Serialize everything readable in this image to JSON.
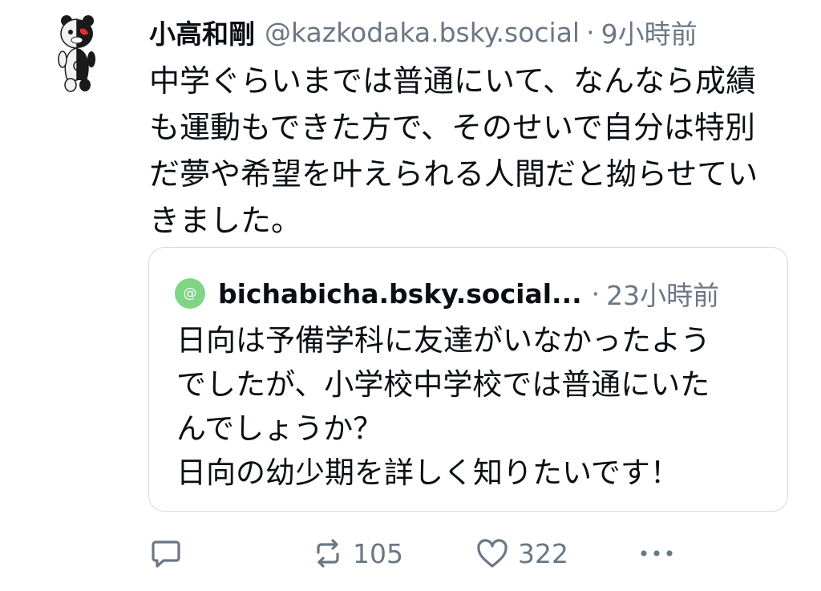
{
  "post": {
    "author_name": "小高和剛",
    "author_handle": "@kazkodaka.bsky.social",
    "separator": "·",
    "time": "9小時前",
    "text": "中学ぐらいまでは普通にいて、なんなら成績\nも運動もできた方で、そのせいで自分は特別\nだ夢や希望を叶えられる人間だと拗らせてい\nきました。",
    "avatar_icon": "monokuma-avatar"
  },
  "quote": {
    "avatar_symbol": "@",
    "avatar_color": "#7fd486",
    "handle": "bichabicha.bsky.social...",
    "separator": "·",
    "time": "23小時前",
    "text": "日向は予備学科に友達がいなかったよう\nでしたが、小学校中学校では普通にいた\nんでしょうか？\n日向の幼少期を詳しく知りたいです！"
  },
  "actions": {
    "reply_icon": "reply-icon",
    "repost_icon": "repost-icon",
    "repost_count": "105",
    "like_icon": "heart-icon",
    "like_count": "322",
    "more_icon": "more-icon"
  },
  "colors": {
    "text": "#0b0f14",
    "muted": "#6b7785",
    "border": "#d4dbe2"
  }
}
